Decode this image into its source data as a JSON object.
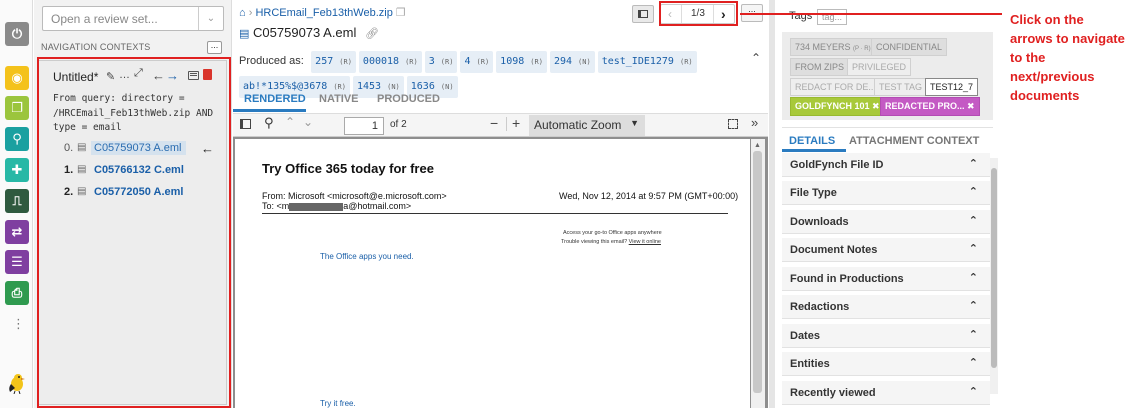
{
  "rail": {
    "icons": [
      "power-icon",
      "eye-icon",
      "copy-icon",
      "search-icon",
      "puzzle-icon",
      "bookmark-icon",
      "transfer-icon",
      "list-icon",
      "print-icon"
    ],
    "colors": [
      "#8a8a8a",
      "#f4c21b",
      "#9bc53d",
      "#1aa0a0",
      "#28b8a6",
      "#2f5a3f",
      "#7f3fa0",
      "#7f3fa0",
      "#2f9a4f"
    ],
    "more": "⋮"
  },
  "nav": {
    "select_placeholder": "Open a review set...",
    "contexts_label": "NAVIGATION CONTEXTS",
    "dots": "...",
    "title": "Untitled*",
    "query_text": "From query: directory = /HRCEmail_Feb13thWeb.zip AND type = email",
    "items": [
      {
        "num": "0.",
        "name": "C05759073 A.eml"
      },
      {
        "num": "1.",
        "name": "C05766132 C.eml"
      },
      {
        "num": "2.",
        "name": "C05772050 A.eml"
      }
    ]
  },
  "main": {
    "breadcrumb": "HRCEmail_Feb13thWeb.zip",
    "doc_title": "C05759073 A.eml",
    "pager": "1/3",
    "produced_label": "Produced as:",
    "chips": [
      {
        "v": "257",
        "s": "(R)"
      },
      {
        "v": "000018",
        "s": "(R)"
      },
      {
        "v": "3",
        "s": "(R)"
      },
      {
        "v": "4",
        "s": "(R)"
      },
      {
        "v": "1098",
        "s": "(R)"
      },
      {
        "v": "294",
        "s": "(N)"
      },
      {
        "v": "test_IDE1279",
        "s": "(R)"
      },
      {
        "v": "ab!*135%$@3678",
        "s": "(R)"
      },
      {
        "v": "1453",
        "s": "(N)"
      },
      {
        "v": "1636",
        "s": "(N)"
      }
    ],
    "tabs": [
      "RENDERED",
      "NATIVE",
      "PRODUCED"
    ],
    "page_num": "1",
    "page_of": "of 2",
    "zoom": "Automatic Zoom"
  },
  "email": {
    "heading": "Try Office 365 today for free",
    "from": "From: Microsoft <microsoft@e.microsoft.com>",
    "date": "Wed, Nov 12, 2014 at 9:57 PM (GMT+00:00)",
    "to_prefix": "To: <m",
    "to_suffix": "a@hotmail.com>",
    "access": "Access your go-to Office apps anywhere",
    "trouble": "Trouble viewing this email?",
    "view_online": "View it online",
    "apps": "The Office apps you need.",
    "try": "Try it free."
  },
  "right": {
    "tags_label": "Tags",
    "tag_input": "tag...",
    "tags": [
      "734 MEYERS",
      "CONFIDENTIAL",
      "FROM ZIPS",
      "PRIVILEGED",
      "REDACT FOR DE...",
      "TEST TAG",
      "TEST12_7",
      "GOLDFYNCH 101",
      "REDACTED PRO..."
    ],
    "tag_small": "(P · R)",
    "detail_tabs": [
      "DETAILS",
      "ATTACHMENT CONTEXT"
    ],
    "sections": [
      "GoldFynch File ID",
      "File Type",
      "Downloads",
      "Document Notes",
      "Found in Productions",
      "Redactions",
      "Dates",
      "Entities",
      "Recently viewed"
    ]
  },
  "annotation": {
    "text": "Click on the arrows to navigate to the next/previous documents"
  }
}
